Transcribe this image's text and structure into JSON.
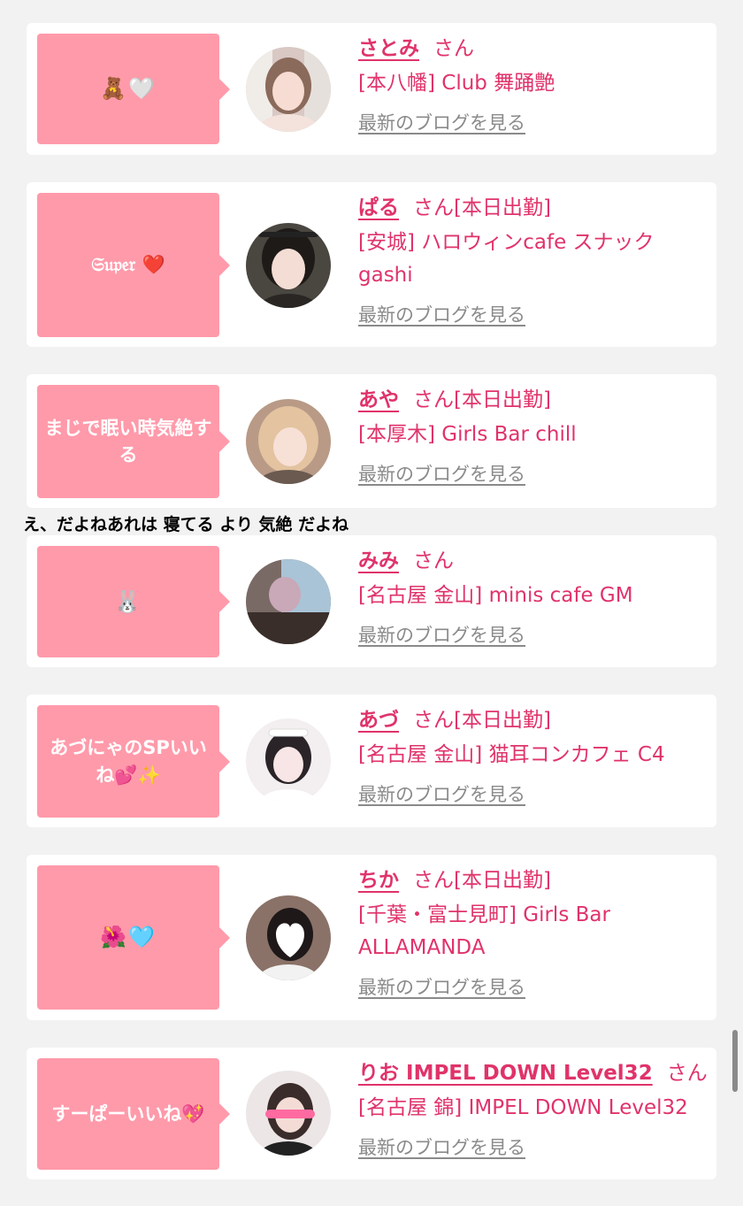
{
  "cards": [
    {
      "message": "🧸🤍",
      "name": "さとみ",
      "san": "さん",
      "status": "",
      "shop": "[本八幡] Club 舞踊艶",
      "blog": "最新のブログを見る"
    },
    {
      "message": "𝔖𝔲𝔭𝔢𝔯 ❤️",
      "name": "ぱる",
      "san": "さん",
      "status": "[本日出勤]",
      "shop": "[安城] ハロウィンcafe スナックgashi",
      "blog": "最新のブログを見る"
    },
    {
      "message": "まじで眠い時気絶する",
      "name": "あや",
      "san": "さん",
      "status": "[本日出勤]",
      "shop": "[本厚木] Girls Bar chill",
      "blog": "最新のブログを見る"
    },
    {
      "message": "🐰",
      "name": "みみ",
      "san": "さん",
      "status": "",
      "shop": "[名古屋 金山] minis cafe GM",
      "blog": "最新のブログを見る"
    },
    {
      "message": "あづにゃのSPいいね💕✨",
      "name": "あづ",
      "san": "さん",
      "status": "[本日出勤]",
      "shop": "[名古屋 金山] 猫耳コンカフェ C4",
      "blog": "最新のブログを見る"
    },
    {
      "message": "🌺🩵",
      "name": "ちか",
      "san": "さん",
      "status": "[本日出勤]",
      "shop": "[千葉・富士見町] Girls Bar ALLAMANDA",
      "blog": "最新のブログを見る"
    },
    {
      "message": "すーぱーいいね💖",
      "name": "りお IMPEL DOWN Level32",
      "san": "さん",
      "status": "",
      "shop": "[名古屋 錦] IMPEL DOWN Level32",
      "blog": "最新のブログを見る"
    }
  ],
  "overlay_caption": "え、だよねあれは 寝てる より 気絶 だよね",
  "colors": {
    "accent": "#e0336a",
    "bubble": "#ff9aaa",
    "link_gray": "#8a8a8a",
    "background": "#f2f2f2"
  }
}
